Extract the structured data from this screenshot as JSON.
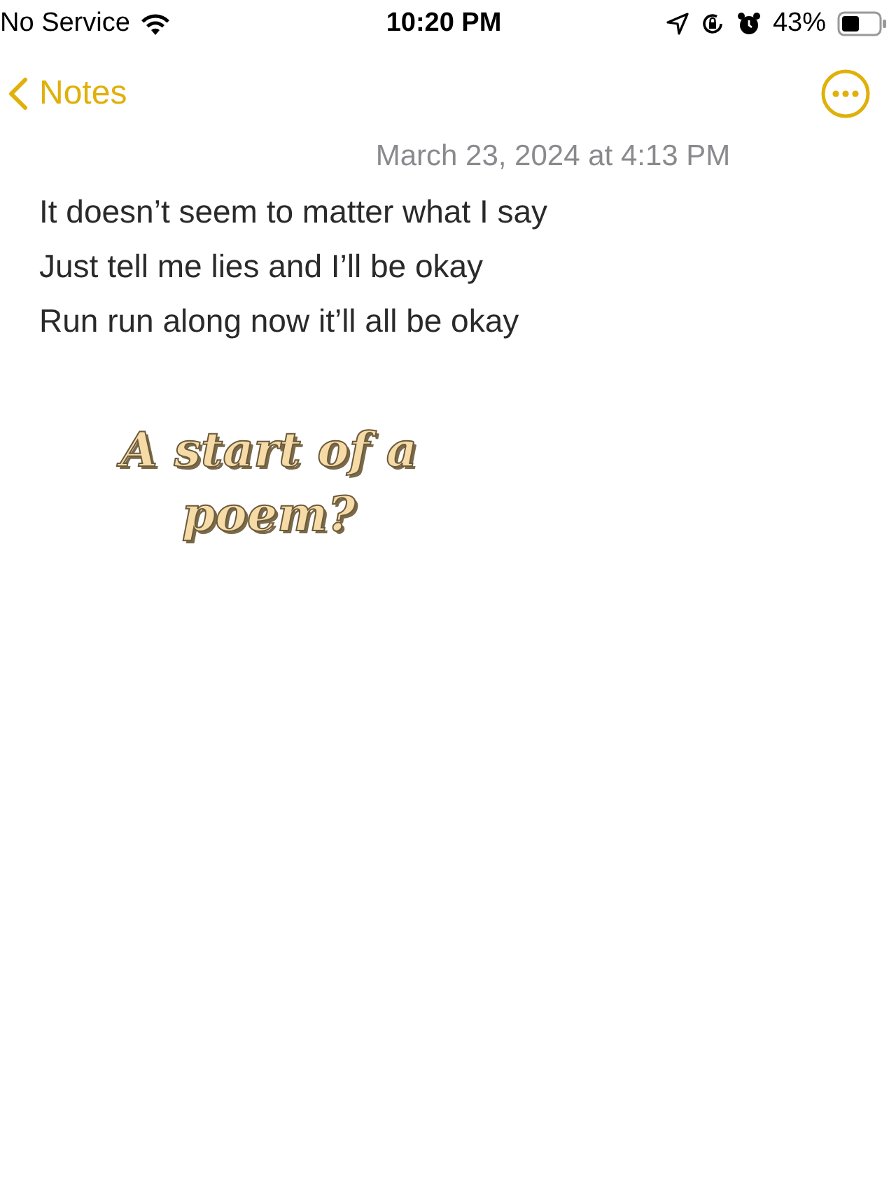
{
  "status_bar": {
    "carrier": "No Service",
    "time": "10:20 PM",
    "battery": "43%"
  },
  "nav": {
    "back": "Notes"
  },
  "note": {
    "date": "March 23, 2024 at 4:13 PM",
    "lines": [
      "It doesn’t seem to matter what I say",
      "Just tell me lies and I’ll be okay",
      "Run run along now it’ll all be okay"
    ]
  },
  "caption": {
    "lines": [
      "A start of a",
      "poem?"
    ]
  }
}
